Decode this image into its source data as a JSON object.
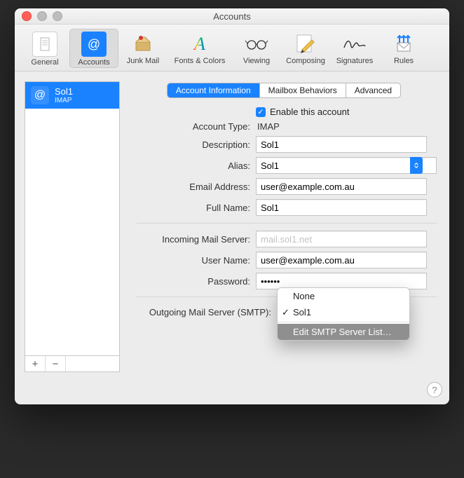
{
  "window": {
    "title": "Accounts"
  },
  "toolbar": {
    "items": [
      {
        "name": "general",
        "label": "General"
      },
      {
        "name": "accounts",
        "label": "Accounts"
      },
      {
        "name": "junk",
        "label": "Junk Mail"
      },
      {
        "name": "fonts",
        "label": "Fonts & Colors"
      },
      {
        "name": "viewing",
        "label": "Viewing"
      },
      {
        "name": "composing",
        "label": "Composing"
      },
      {
        "name": "signatures",
        "label": "Signatures"
      },
      {
        "name": "rules",
        "label": "Rules"
      }
    ]
  },
  "sidebar": {
    "accounts": [
      {
        "name": "Sol1",
        "sub": "IMAP"
      }
    ],
    "add": "+",
    "remove": "−"
  },
  "tabs": {
    "info": "Account Information",
    "mailbox": "Mailbox Behaviors",
    "adv": "Advanced"
  },
  "form": {
    "enable_label": "Enable this account",
    "enable_checked": true,
    "type_label": "Account Type:",
    "type_value": "IMAP",
    "desc_label": "Description:",
    "desc_value": "Sol1",
    "alias_label": "Alias:",
    "alias_value": "Sol1",
    "email_label": "Email Address:",
    "email_value": "user@example.com.au",
    "fullname_label": "Full Name:",
    "fullname_value": "Sol1",
    "inserver_label": "Incoming Mail Server:",
    "inserver_value": "mail.sol1.net",
    "user_label": "User Name:",
    "user_value": "user@example.com.au",
    "pass_label": "Password:",
    "pass_value": "••••••",
    "smtp_label": "Outgoing Mail Server (SMTP):"
  },
  "smtp_menu": {
    "none": "None",
    "selected": "Sol1",
    "edit": "Edit SMTP Server List…"
  },
  "help": "?"
}
